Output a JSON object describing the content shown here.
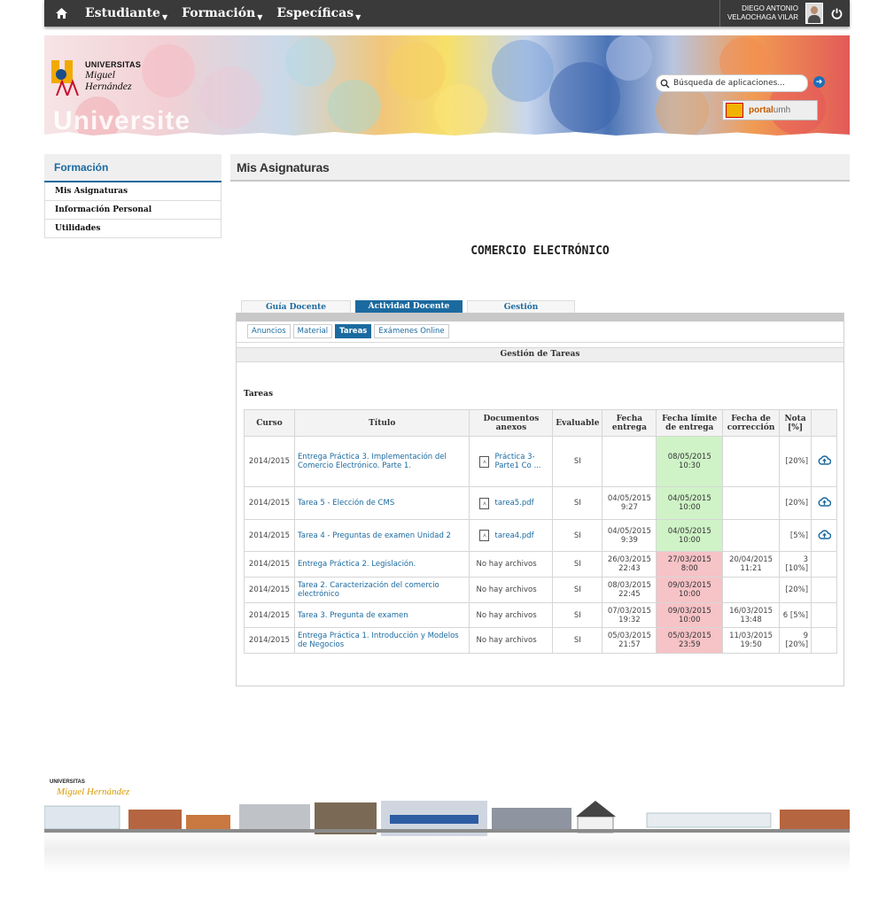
{
  "topbar": {
    "menus": [
      "Estudiante",
      "Formación",
      "Específicas"
    ],
    "user_line1": "DIEGO ANTONIO",
    "user_line2": "VELAOCHAGA VILAR"
  },
  "banner": {
    "logo_line1": "UNIVERSITAS",
    "logo_line2": "Miguel",
    "logo_line3": "Hernández",
    "wordmark": "Universite",
    "search_placeholder": "Búsqueda de aplicaciones...",
    "portal_part1": "portal",
    "portal_part2": "umh"
  },
  "sidebar": {
    "title": "Formación",
    "items": [
      "Mis Asignaturas",
      "Información Personal",
      "Utilidades"
    ]
  },
  "main": {
    "page_title": "Mis Asignaturas",
    "course_title": "COMERCIO ELECTRÓNICO",
    "tabs": [
      "Guía Docente",
      "Actividad Docente",
      "Gestión"
    ],
    "subtabs": [
      "Anuncios",
      "Material",
      "Tareas",
      "Exámenes Online"
    ],
    "section_title": "Gestión de Tareas",
    "tareas_label": "Tareas"
  },
  "table": {
    "headers": [
      "Curso",
      "Título",
      "Documentos anexos",
      "Evaluable",
      "Fecha entrega",
      "Fecha límite de entrega",
      "Fecha de corrección",
      "Nota [%]"
    ],
    "rows": [
      {
        "curso": "2014/2015",
        "titulo": "Entrega Práctica 3. Implementación del Comercio Electrónico. Parte 1.",
        "doc": "Práctica 3-Parte1 Co ...",
        "evaluable": "SI",
        "entrega": "",
        "limite": "08/05/2015 10:30",
        "limite_status": "green",
        "correccion": "",
        "nota": "[20%]",
        "upload": true
      },
      {
        "curso": "2014/2015",
        "titulo": "Tarea 5 - Elección de CMS",
        "doc": "tarea5.pdf",
        "evaluable": "SI",
        "entrega": "04/05/2015 9:27",
        "limite": "04/05/2015 10:00",
        "limite_status": "green",
        "correccion": "",
        "nota": "[20%]",
        "upload": true
      },
      {
        "curso": "2014/2015",
        "titulo": "Tarea 4 - Preguntas de examen Unidad 2",
        "doc": "tarea4.pdf",
        "evaluable": "SI",
        "entrega": "04/05/2015 9:39",
        "limite": "04/05/2015 10:00",
        "limite_status": "green",
        "correccion": "",
        "nota": "[5%]",
        "upload": true
      },
      {
        "curso": "2014/2015",
        "titulo": "Entrega Práctica 2. Legislación.",
        "doc": "No hay archivos",
        "evaluable": "SI",
        "entrega": "26/03/2015 22:43",
        "limite": "27/03/2015 8:00",
        "limite_status": "red",
        "correccion": "20/04/2015 11:21",
        "nota": "3 [10%]",
        "upload": false
      },
      {
        "curso": "2014/2015",
        "titulo": "Tarea 2. Caracterización del comercio electrónico",
        "doc": "No hay archivos",
        "evaluable": "SI",
        "entrega": "08/03/2015 22:45",
        "limite": "09/03/2015 10:00",
        "limite_status": "red",
        "correccion": "",
        "nota": "[20%]",
        "upload": false
      },
      {
        "curso": "2014/2015",
        "titulo": "Tarea 3. Pregunta de examen",
        "doc": "No hay archivos",
        "evaluable": "SI",
        "entrega": "07/03/2015 19:32",
        "limite": "09/03/2015 10:00",
        "limite_status": "red",
        "correccion": "16/03/2015 13:48",
        "nota": "6 [5%]",
        "upload": false
      },
      {
        "curso": "2014/2015",
        "titulo": "Entrega Práctica 1. Introducción y Modelos de Negocios",
        "doc": "No hay archivos",
        "evaluable": "SI",
        "entrega": "05/03/2015 21:57",
        "limite": "05/03/2015 23:59",
        "limite_status": "red",
        "correccion": "11/03/2015 19:50",
        "nota": "9 [20%]",
        "upload": false
      }
    ]
  },
  "footer": {
    "logo_line1": "UNIVERSITAS",
    "logo_line2": "Miguel Hernández"
  },
  "colors": {
    "accent": "#1b6a9f",
    "topbar": "#3a3a3a",
    "deadline_ok": "#cff3c7",
    "deadline_late": "#f6c3c7"
  }
}
